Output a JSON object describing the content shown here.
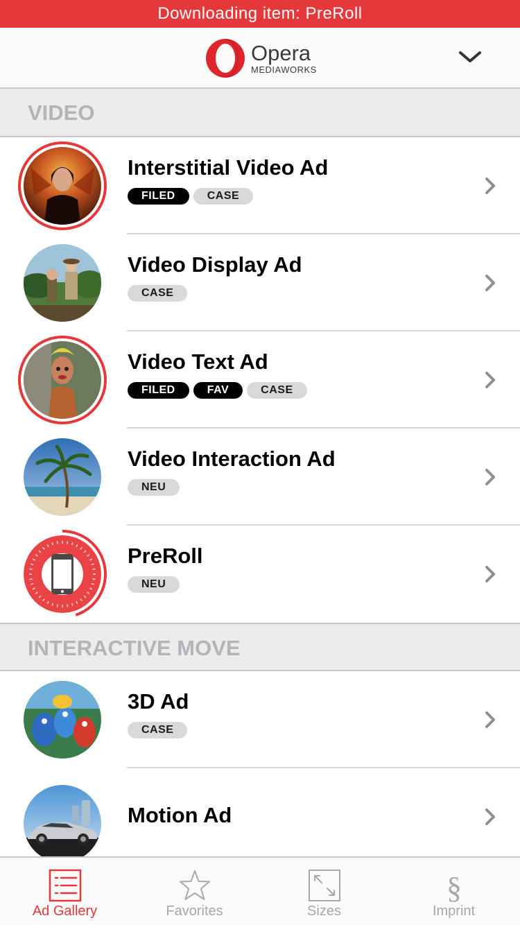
{
  "status": {
    "text": "Downloading item: PreRoll",
    "color": "#e5383b"
  },
  "header": {
    "brand_name": "Opera",
    "brand_sub": "MEDIAWORKS",
    "dropdown_icon": "chevron-down-icon"
  },
  "sections": [
    {
      "title": "VIDEO",
      "items": [
        {
          "title": "Interstitial Video Ad",
          "tags": [
            {
              "label": "FILED",
              "style": "dark"
            },
            {
              "label": "CASE",
              "style": "light"
            }
          ],
          "thumb": "portrait-fire-image",
          "highlight": true
        },
        {
          "title": "Video Display Ad",
          "tags": [
            {
              "label": "CASE",
              "style": "light"
            }
          ],
          "thumb": "jungle-explorers-image",
          "highlight": false
        },
        {
          "title": "Video Text Ad",
          "tags": [
            {
              "label": "FILED",
              "style": "dark"
            },
            {
              "label": "FAV",
              "style": "dark"
            },
            {
              "label": "CASE",
              "style": "light"
            }
          ],
          "thumb": "animated-character-image",
          "highlight": true
        },
        {
          "title": "Video Interaction Ad",
          "tags": [
            {
              "label": "NEU",
              "style": "light"
            }
          ],
          "thumb": "palm-beach-image",
          "highlight": false
        },
        {
          "title": "PreRoll",
          "tags": [
            {
              "label": "NEU",
              "style": "light"
            }
          ],
          "thumb": "phone-download-progress",
          "highlight": true,
          "progress": 0.45
        }
      ]
    },
    {
      "title": "INTERACTIVE MOVE",
      "items": [
        {
          "title": "3D Ad",
          "tags": [
            {
              "label": "CASE",
              "style": "light"
            }
          ],
          "thumb": "animated-birds-image",
          "highlight": false
        },
        {
          "title": "Motion Ad",
          "tags": [],
          "thumb": "silver-car-image",
          "highlight": false
        }
      ]
    }
  ],
  "tabbar": {
    "active": "Ad Gallery",
    "accent": "#e5383b",
    "inactive_color": "#a8a8ac",
    "tabs": [
      {
        "label": "Ad Gallery",
        "icon": "list-icon"
      },
      {
        "label": "Favorites",
        "icon": "star-icon"
      },
      {
        "label": "Sizes",
        "icon": "resize-icon"
      },
      {
        "label": "Imprint",
        "icon": "section-sign-icon"
      }
    ]
  }
}
